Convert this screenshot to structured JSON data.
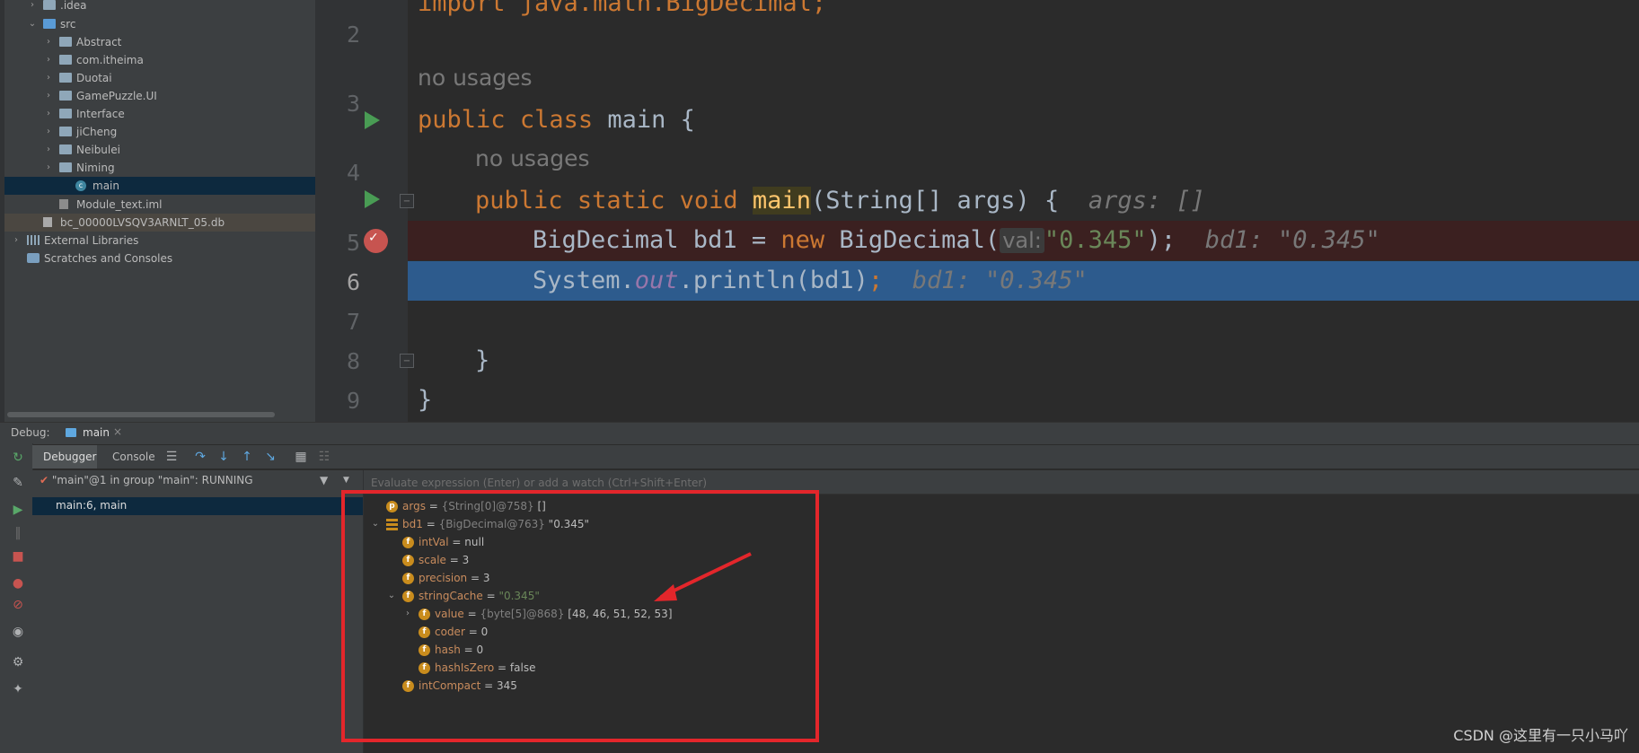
{
  "project_tree": [
    {
      "label": ".idea",
      "type": "folder",
      "depth": 1,
      "expanded": false
    },
    {
      "label": "src",
      "type": "folder-src",
      "depth": 1,
      "expanded": true
    },
    {
      "label": "Abstract",
      "type": "folder",
      "depth": 2,
      "expanded": false
    },
    {
      "label": "com.itheima",
      "type": "folder",
      "depth": 2,
      "expanded": false
    },
    {
      "label": "Duotai",
      "type": "folder",
      "depth": 2,
      "expanded": false
    },
    {
      "label": "GamePuzzle.UI",
      "type": "folder",
      "depth": 2,
      "expanded": false
    },
    {
      "label": "Interface",
      "type": "folder",
      "depth": 2,
      "expanded": false
    },
    {
      "label": "jiCheng",
      "type": "folder",
      "depth": 2,
      "expanded": false
    },
    {
      "label": "Neibulei",
      "type": "folder",
      "depth": 2,
      "expanded": false
    },
    {
      "label": "Niming",
      "type": "folder",
      "depth": 2,
      "expanded": false
    },
    {
      "label": "main",
      "type": "class",
      "depth": 3,
      "selected": true
    },
    {
      "label": "Module_text.iml",
      "type": "file",
      "depth": 2
    },
    {
      "label": "bc_00000LVSQV3ARNLT_05.db",
      "type": "db",
      "depth": 1
    },
    {
      "label": "External Libraries",
      "type": "lib",
      "depth": 0,
      "expanded": false
    },
    {
      "label": "Scratches and Consoles",
      "type": "scratch",
      "depth": 0
    }
  ],
  "editor": {
    "line_numbers": [
      "2",
      "3",
      "4",
      "5",
      "6",
      "7",
      "8",
      "9"
    ],
    "top_partial": "import java.math.BigDecimal;",
    "no_usages_1": "no usages",
    "no_usages_2": "no usages",
    "line3": {
      "kw1": "public",
      "kw2": "class",
      "name": "main",
      "brace": "{"
    },
    "line4": {
      "kw1": "public",
      "kw2": "static",
      "kw3": "void",
      "method": "main",
      "params": "(String[] args) {",
      "hint": "args: []"
    },
    "line5": {
      "type": "BigDecimal bd1 = ",
      "kw": "new",
      "ctor": " BigDecimal(",
      "param_hint": "val:",
      "str": "\"0.345\"",
      "end": ");",
      "hint": "bd1: \"0.345\""
    },
    "line6": {
      "obj": "System.",
      "field": "out",
      "call": ".println(bd1)",
      "semi": ";",
      "hint": "bd1: \"0.345\""
    },
    "line8": "}",
    "line9": "}"
  },
  "debug": {
    "title": "Debug:",
    "tab_label": "main",
    "tabs": [
      "Debugger",
      "Console"
    ],
    "thread": "\"main\"@1 in group \"main\": RUNNING",
    "frame": "main:6, main",
    "eval_placeholder": "Evaluate expression (Enter) or add a watch (Ctrl+Shift+Enter)",
    "variables": [
      {
        "depth": 0,
        "arrow": "",
        "icon": "p",
        "name": "args",
        "eq": " = ",
        "type": "{String[0]@758}",
        "value": " []"
      },
      {
        "depth": 0,
        "arrow": "v",
        "icon": "list",
        "name": "bd1",
        "eq": " = ",
        "type": "{BigDecimal@763}",
        "value": " \"0.345\""
      },
      {
        "depth": 1,
        "arrow": "",
        "icon": "f",
        "name": "intVal",
        "eq": " = ",
        "type": "",
        "value": "null"
      },
      {
        "depth": 1,
        "arrow": "",
        "icon": "f",
        "name": "scale",
        "eq": " = ",
        "type": "",
        "value": "3"
      },
      {
        "depth": 1,
        "arrow": "",
        "icon": "f",
        "name": "precision",
        "eq": " = ",
        "type": "",
        "value": "3"
      },
      {
        "depth": 1,
        "arrow": "v",
        "icon": "f",
        "name": "stringCache",
        "eq": " = ",
        "type": "",
        "value": "\"0.345\"",
        "string": true
      },
      {
        "depth": 2,
        "arrow": ">",
        "icon": "f",
        "name": "value",
        "eq": " = ",
        "type": "{byte[5]@868}",
        "value": " [48, 46, 51, 52, 53]"
      },
      {
        "depth": 2,
        "arrow": "",
        "icon": "f",
        "name": "coder",
        "eq": " = ",
        "type": "",
        "value": "0"
      },
      {
        "depth": 2,
        "arrow": "",
        "icon": "f",
        "name": "hash",
        "eq": " = ",
        "type": "",
        "value": "0"
      },
      {
        "depth": 2,
        "arrow": "",
        "icon": "f",
        "name": "hashIsZero",
        "eq": " = ",
        "type": "",
        "value": "false"
      },
      {
        "depth": 1,
        "arrow": "",
        "icon": "f",
        "name": "intCompact",
        "eq": " = ",
        "type": "",
        "value": "345"
      }
    ]
  },
  "watermark": "CSDN @这里有一只小马吖",
  "colors": {
    "annotation": "#e3262b",
    "exec_line": "#2d5b8d",
    "breakpoint": "#c75450",
    "run": "#499c54"
  }
}
